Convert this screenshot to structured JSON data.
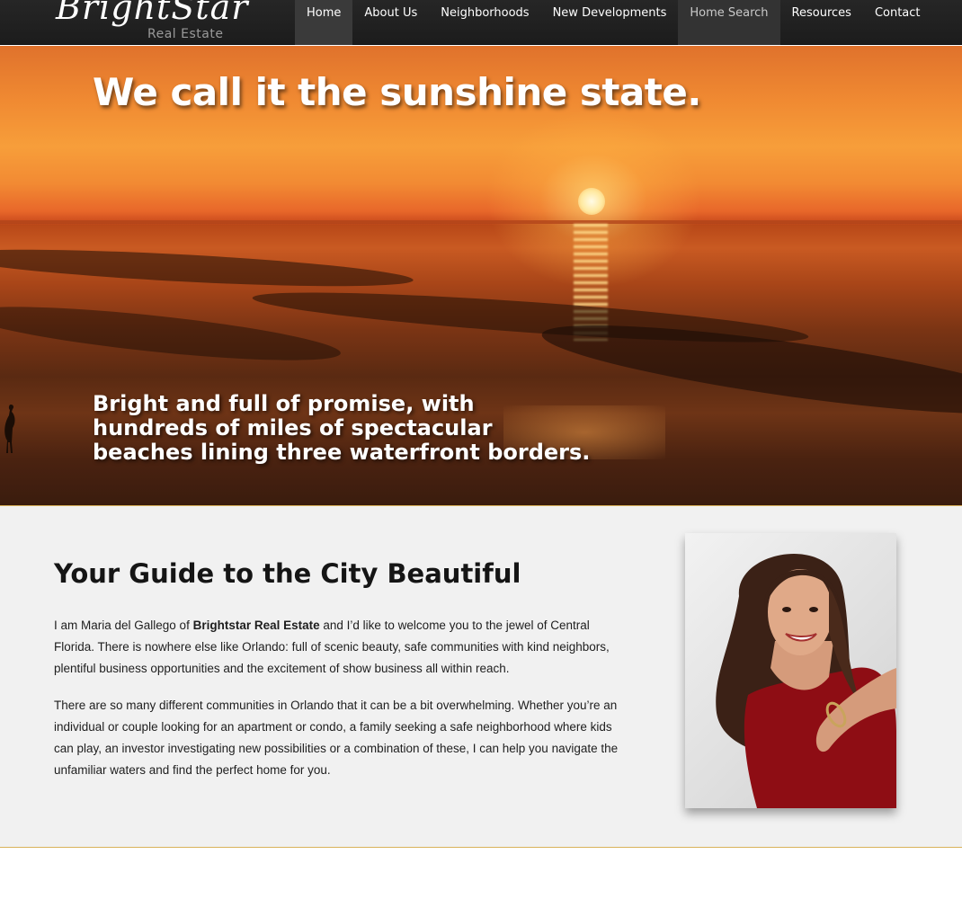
{
  "brand": {
    "name": "BrightStar",
    "tagline": "Real Estate"
  },
  "nav": {
    "items": [
      {
        "label": "Home"
      },
      {
        "label": "About Us"
      },
      {
        "label": "Neighborhoods"
      },
      {
        "label": "New Developments"
      },
      {
        "label": "Home Search"
      },
      {
        "label": "Resources"
      },
      {
        "label": "Contact"
      }
    ]
  },
  "hero": {
    "title": "We call it the sunshine state.",
    "subtitle_lines": [
      "Bright and full of promise, with",
      "hundreds of miles of spectacular",
      "beaches lining three waterfront borders."
    ]
  },
  "intro": {
    "heading": "Your Guide to the City Beautiful",
    "para1_before": "I am Maria del Gallego of ",
    "para1_bold": "Brightstar Real Estate",
    "para1_after": " and I’d like to welcome you to the jewel of Central Florida. There is nowhere else like Orlando: full of scenic beauty, safe communities with kind neighbors, plentiful business opportunities and the excitement of show business all within reach.",
    "para2": "There are so many different communities in Orlando that it can be a bit overwhelming. Whether you’re an individual or couple looking for an apartment or condo, a family seeking a safe neighborhood where kids can play, an investor investigating new possibilities or a combination of these, I can help you navigate the unfamiliar waters and find the perfect home for you."
  },
  "colors": {
    "nav_bg": "#222222",
    "accent_border": "#d9b25a",
    "content_bg": "#f1f1f1"
  }
}
